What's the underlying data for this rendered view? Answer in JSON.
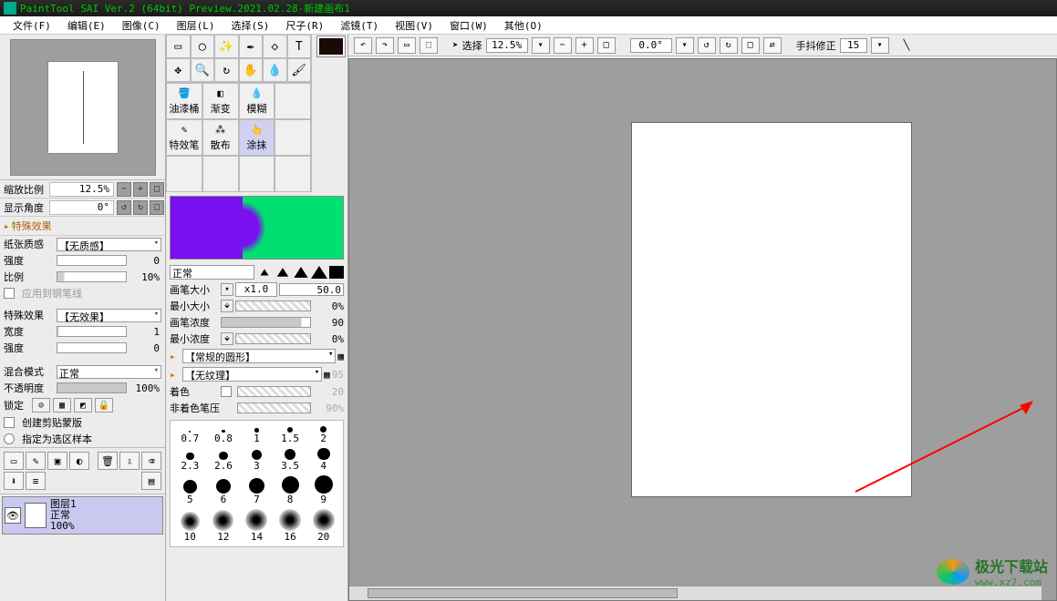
{
  "title": {
    "app": "PaintTool SAI Ver.2 (64bit) Preview.2021.02.28",
    "sep": " - ",
    "doc": "新建画布1"
  },
  "menu": [
    "文件(F)",
    "编辑(E)",
    "图像(C)",
    "图层(L)",
    "选择(S)",
    "尺子(R)",
    "滤镜(T)",
    "视图(V)",
    "窗口(W)",
    "其他(O)"
  ],
  "nav": {
    "zoom_label": "缩放比例",
    "zoom_value": "12.5%",
    "angle_label": "显示角度",
    "angle_value": "0°"
  },
  "effects": {
    "header": "特殊效果",
    "paper_label": "纸张质感",
    "paper_value": "【无质感】",
    "intensity_label": "强度",
    "intensity_value": "0",
    "ratio_label": "比例",
    "ratio_value": "10%",
    "apply_pen": "应用到钢笔线",
    "fx_label": "特殊效果",
    "fx_value": "【无效果】",
    "width_label": "宽度",
    "width_value": "1",
    "intensity2_label": "强度",
    "intensity2_value": "0"
  },
  "blend": {
    "mode_label": "混合模式",
    "mode_value": "正常",
    "opacity_label": "不透明度",
    "opacity_value": "100%",
    "lock_label": "锁定",
    "clip_label": "创建剪贴蒙版",
    "mark_label": "指定为选区样本"
  },
  "layer": {
    "name": "图层1",
    "mode": "正常",
    "opacity": "100%"
  },
  "tools_row2": [
    "油漆桶",
    "渐变",
    "模糊"
  ],
  "tools_row3": [
    "特效笔",
    "散布",
    "涂抹"
  ],
  "color_mode": "正常",
  "brush": {
    "size_label": "画笔大小",
    "size_mult": "x1.0",
    "size_val": "50.0",
    "min_size_label": "最小大小",
    "min_size_val": "0%",
    "density_label": "画笔浓度",
    "density_val": "90",
    "min_density_label": "最小浓度",
    "min_density_val": "0%",
    "shape_label": "【常规的圆形】",
    "texture_label": "【无纹理】",
    "texture_val": "95",
    "tint_label": "着色",
    "tint_val": "20",
    "tint_press_label": "非着色笔压",
    "tint_press_val": "90%"
  },
  "brush_sizes": [
    "0.7",
    "0.8",
    "1",
    "1.5",
    "2",
    "2.3",
    "2.6",
    "3",
    "3.5",
    "4",
    "5",
    "6",
    "7",
    "8",
    "9",
    "10",
    "12",
    "14",
    "16",
    "20"
  ],
  "top_toolbar": {
    "select_label": "选择",
    "zoom": "12.5%",
    "angle": "0.0°",
    "stabilizer_label": "手抖修正",
    "stabilizer_val": "15"
  },
  "watermark": {
    "t1": "极光下载站",
    "t2": "www.xz7.com"
  }
}
